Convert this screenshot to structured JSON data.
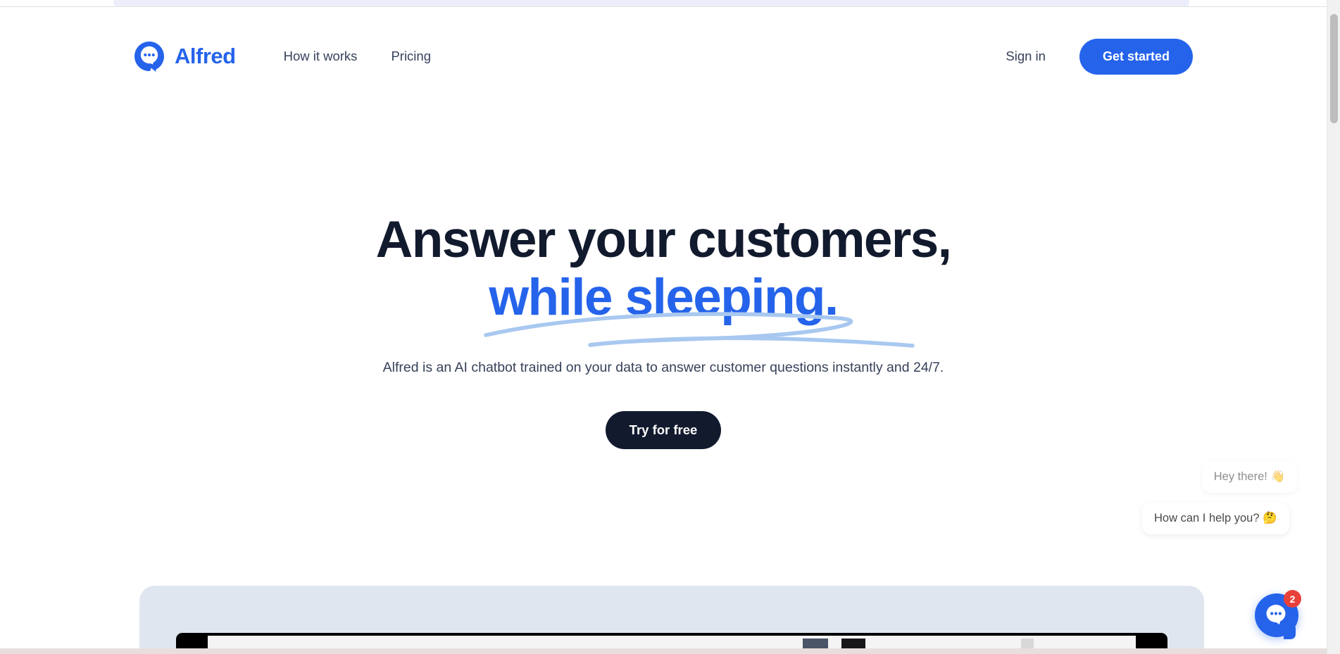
{
  "brand": {
    "name": "Alfred",
    "logo_icon": "chat-bubble-logo-icon",
    "color": "#2563eb"
  },
  "header": {
    "nav": [
      {
        "label": "How it works"
      },
      {
        "label": "Pricing"
      }
    ],
    "sign_in_label": "Sign in",
    "get_started_label": "Get started"
  },
  "hero": {
    "title_line1": "Answer your customers,",
    "title_line2": "while sleeping.",
    "title_color": "#121a2e",
    "accent_color": "#2563eb",
    "underline_color": "#a8c8f0",
    "subtitle": "Alfred is an AI chatbot trained on your data to answer customer questions instantly and 24/7.",
    "cta_label": "Try for free",
    "cta_bg": "#121a2e"
  },
  "chat_widget": {
    "messages": [
      {
        "text": "Hey there! 👋",
        "style": "faded"
      },
      {
        "text": "How can I help you? 🤔",
        "style": "primary"
      }
    ],
    "badge_count": "2",
    "badge_color": "#e8413a",
    "launcher_icon": "chat-bubble-icon",
    "launcher_color": "#2563eb"
  },
  "showcase": {
    "panel_color": "#dfe6ef"
  }
}
